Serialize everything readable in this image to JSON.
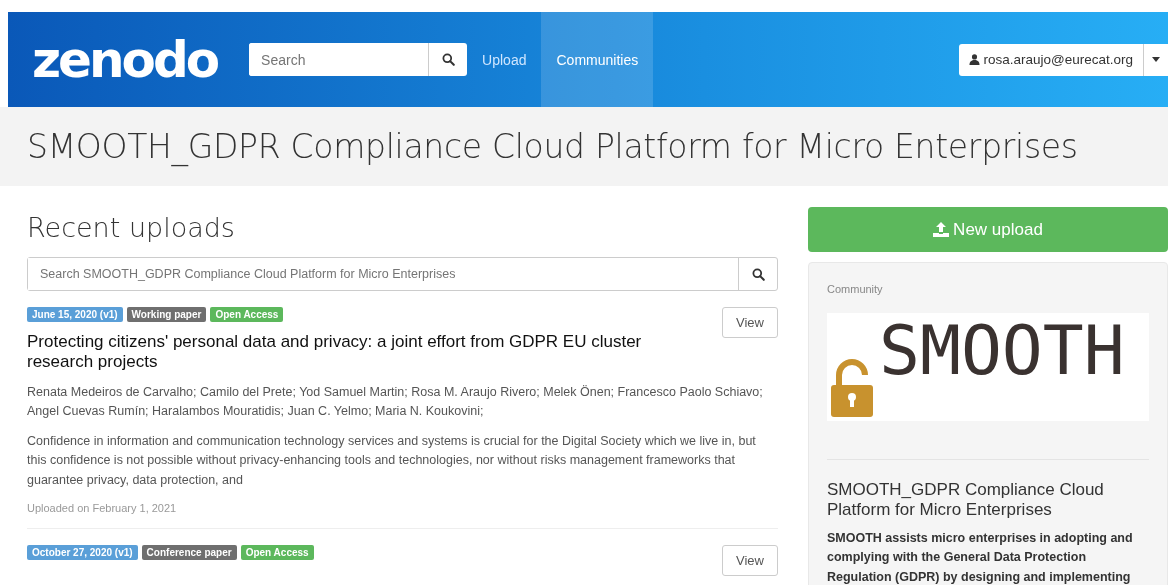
{
  "navbar": {
    "logo": "zenodo",
    "search": {
      "placeholder": "Search"
    },
    "links": [
      {
        "label": "Upload",
        "selected": false
      },
      {
        "label": "Communities",
        "selected": true
      }
    ],
    "user": "rosa.araujo@eurecat.org"
  },
  "page_title": "SMOOTH_GDPR Compliance Cloud Platform for Micro Enterprises",
  "recent": {
    "heading": "Recent uploads",
    "search": {
      "placeholder": "Search SMOOTH_GDPR Compliance Cloud Platform for Micro Enterprises"
    },
    "records": [
      {
        "badges": [
          {
            "kind": "date",
            "text": "June 15, 2020 (v1)"
          },
          {
            "kind": "type",
            "text": "Working paper"
          },
          {
            "kind": "access",
            "text": "Open Access"
          }
        ],
        "view": "View",
        "title": "Protecting citizens' personal data and privacy: a joint effort from GDPR EU cluster research projects",
        "authors": "Renata Medeiros de Carvalho; Camilo del Prete; Yod Samuel Martin; Rosa M. Araujo Rivero; Melek Önen; Francesco Paolo Schiavo; Angel Cuevas Rumín; Haralambos Mouratidis; Juan C. Yelmo; Maria N. Koukovini;",
        "abstract": "Confidence in information and communication technology services and systems is crucial for the Digital Society which we live in, but this confidence is not possible without privacy-enhancing tools and technologies, nor without risks management frameworks that guarantee privacy, data protection, and",
        "uploaded": "Uploaded on February 1, 2021"
      },
      {
        "badges": [
          {
            "kind": "date",
            "text": "October 27, 2020 (v1)"
          },
          {
            "kind": "type",
            "text": "Conference paper"
          },
          {
            "kind": "access",
            "text": "Open Access"
          }
        ],
        "view": "View"
      }
    ]
  },
  "sidebar": {
    "new_upload": "New upload",
    "label": "Community",
    "logo_text": "SMOOTH",
    "name": "SMOOTH_GDPR Compliance Cloud Platform for Micro Enterprises",
    "description": "SMOOTH assists micro enterprises in adopting and complying with the General Data Protection Regulation (GDPR) by designing and implementing"
  }
}
